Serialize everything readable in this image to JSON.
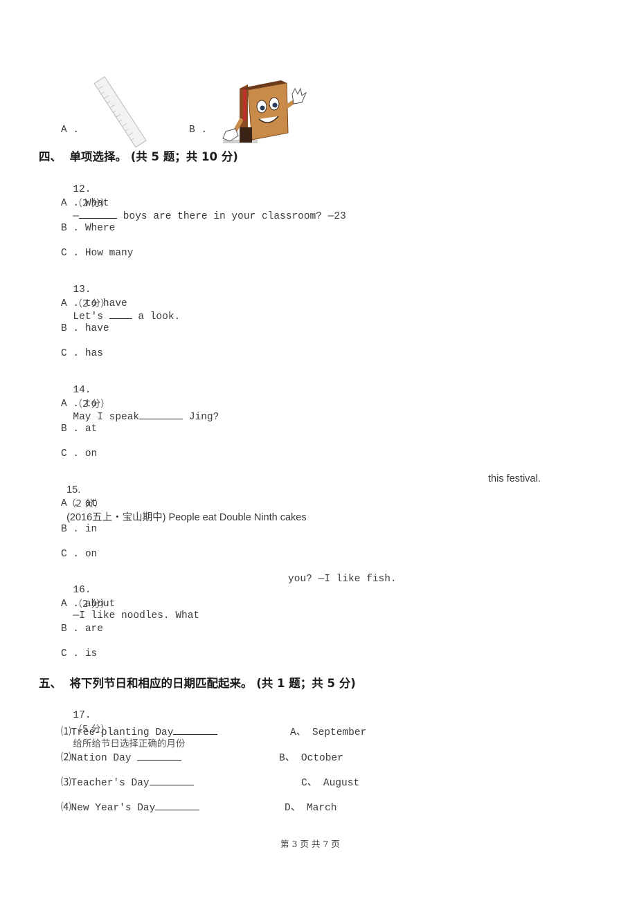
{
  "top_options": {
    "a_label": "A .",
    "b_label": "B .",
    "a_image": "ruler-image",
    "b_image": "cartoon-book-image"
  },
  "section4": {
    "title": "四、  单项选择。 (共 5 题；共 10 分)",
    "questions": [
      {
        "num": "12.",
        "score": "（2 分）",
        "pre": "—",
        "post": " boys are there in your classroom? —23",
        "options": [
          {
            "label": "A .",
            "text": "What"
          },
          {
            "label": "B .",
            "text": "Where"
          },
          {
            "label": "C .",
            "text": "How many"
          }
        ]
      },
      {
        "num": "13.",
        "score": "（2 分）",
        "pre": "Let's ",
        "post": " a look.",
        "options": [
          {
            "label": "A .",
            "text": "to have"
          },
          {
            "label": "B .",
            "text": "have"
          },
          {
            "label": "C .",
            "text": "has"
          }
        ]
      },
      {
        "num": "14.",
        "score": "（2 分）",
        "pre": "May I speak",
        "post": " Jing?",
        "options": [
          {
            "label": "A .",
            "text": "to"
          },
          {
            "label": "B .",
            "text": "at"
          },
          {
            "label": "C .",
            "text": "on"
          }
        ]
      },
      {
        "num": "15.",
        "score": "（2 分）",
        "pre": "(2016五上・宝山期中) People eat Double Ninth cakes",
        "post": "this festival.",
        "options": [
          {
            "label": "A .",
            "text": "at"
          },
          {
            "label": "B .",
            "text": "in"
          },
          {
            "label": "C .",
            "text": "on"
          }
        ]
      },
      {
        "num": "16.",
        "score": "（2 分）",
        "pre": "—I like noodles. What",
        "post": "you? —I like fish.",
        "options": [
          {
            "label": "A .",
            "text": "about"
          },
          {
            "label": "B .",
            "text": "are"
          },
          {
            "label": "C .",
            "text": "is"
          }
        ]
      }
    ]
  },
  "section5": {
    "title": "五、  将下列节日和相应的日期匹配起来。 (共 1 题；共 5 分)",
    "question": {
      "num": "17.",
      "score": "（5 分）",
      "prompt": "给所给节日选择正确的月份"
    },
    "left_items": [
      "⑴Tree-planting Day",
      "⑵Nation Day ",
      "⑶Teacher's Day",
      "⑷New Year's Day"
    ],
    "right_items": [
      "A、 September",
      "B、 October",
      "C、 August",
      "D、 March"
    ]
  },
  "footer": {
    "page_text": "第 3 页 共 7 页"
  }
}
